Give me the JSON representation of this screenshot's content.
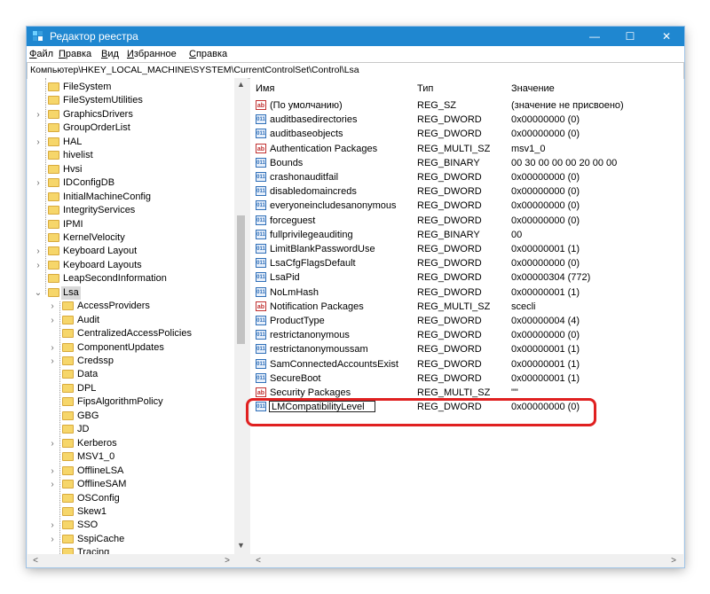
{
  "window": {
    "title": "Редактор реестра",
    "controls": {
      "minimize": "—",
      "maximize": "☐",
      "close": "✕"
    }
  },
  "menu": [
    "Файл",
    "Правка",
    "Вид",
    "Избранное",
    "Справка"
  ],
  "address": "Компьютер\\HKEY_LOCAL_MACHINE\\SYSTEM\\CurrentControlSet\\Control\\Lsa",
  "tree": {
    "items": [
      {
        "label": "FileSystem",
        "level": 0,
        "expander": ""
      },
      {
        "label": "FileSystemUtilities",
        "level": 0,
        "expander": ""
      },
      {
        "label": "GraphicsDrivers",
        "level": 0,
        "expander": ">"
      },
      {
        "label": "GroupOrderList",
        "level": 0,
        "expander": ""
      },
      {
        "label": "HAL",
        "level": 0,
        "expander": ">"
      },
      {
        "label": "hivelist",
        "level": 0,
        "expander": ""
      },
      {
        "label": "Hvsi",
        "level": 0,
        "expander": ""
      },
      {
        "label": "IDConfigDB",
        "level": 0,
        "expander": ">"
      },
      {
        "label": "InitialMachineConfig",
        "level": 0,
        "expander": ""
      },
      {
        "label": "IntegrityServices",
        "level": 0,
        "expander": ""
      },
      {
        "label": "IPMI",
        "level": 0,
        "expander": ""
      },
      {
        "label": "KernelVelocity",
        "level": 0,
        "expander": ""
      },
      {
        "label": "Keyboard Layout",
        "level": 0,
        "expander": ">"
      },
      {
        "label": "Keyboard Layouts",
        "level": 0,
        "expander": ">"
      },
      {
        "label": "LeapSecondInformation",
        "level": 0,
        "expander": ""
      },
      {
        "label": "Lsa",
        "level": 0,
        "expander": "v",
        "selected": true
      },
      {
        "label": "AccessProviders",
        "level": 1,
        "expander": ">"
      },
      {
        "label": "Audit",
        "level": 1,
        "expander": ">"
      },
      {
        "label": "CentralizedAccessPolicies",
        "level": 1,
        "expander": ""
      },
      {
        "label": "ComponentUpdates",
        "level": 1,
        "expander": ">"
      },
      {
        "label": "Credssp",
        "level": 1,
        "expander": ">"
      },
      {
        "label": "Data",
        "level": 1,
        "expander": ""
      },
      {
        "label": "DPL",
        "level": 1,
        "expander": ""
      },
      {
        "label": "FipsAlgorithmPolicy",
        "level": 1,
        "expander": ""
      },
      {
        "label": "GBG",
        "level": 1,
        "expander": ""
      },
      {
        "label": "JD",
        "level": 1,
        "expander": ""
      },
      {
        "label": "Kerberos",
        "level": 1,
        "expander": ">"
      },
      {
        "label": "MSV1_0",
        "level": 1,
        "expander": ""
      },
      {
        "label": "OfflineLSA",
        "level": 1,
        "expander": ">"
      },
      {
        "label": "OfflineSAM",
        "level": 1,
        "expander": ">"
      },
      {
        "label": "OSConfig",
        "level": 1,
        "expander": ""
      },
      {
        "label": "Skew1",
        "level": 1,
        "expander": ""
      },
      {
        "label": "SSO",
        "level": 1,
        "expander": ">"
      },
      {
        "label": "SspiCache",
        "level": 1,
        "expander": ">"
      },
      {
        "label": "Tracing",
        "level": 1,
        "expander": ""
      }
    ]
  },
  "list": {
    "headers": {
      "name": "Имя",
      "type": "Тип",
      "value": "Значение"
    },
    "rows": [
      {
        "icon": "string-value-icon",
        "name": "(По умолчанию)",
        "type": "REG_SZ",
        "value": "(значение не присвоено)"
      },
      {
        "icon": "binary-value-icon",
        "name": "auditbasedirectories",
        "type": "REG_DWORD",
        "value": "0x00000000 (0)"
      },
      {
        "icon": "binary-value-icon",
        "name": "auditbaseobjects",
        "type": "REG_DWORD",
        "value": "0x00000000 (0)"
      },
      {
        "icon": "string-value-icon",
        "name": "Authentication Packages",
        "type": "REG_MULTI_SZ",
        "value": "msv1_0"
      },
      {
        "icon": "binary-value-icon",
        "name": "Bounds",
        "type": "REG_BINARY",
        "value": "00 30 00 00 00 20 00 00"
      },
      {
        "icon": "binary-value-icon",
        "name": "crashonauditfail",
        "type": "REG_DWORD",
        "value": "0x00000000 (0)"
      },
      {
        "icon": "binary-value-icon",
        "name": "disabledomaincreds",
        "type": "REG_DWORD",
        "value": "0x00000000 (0)"
      },
      {
        "icon": "binary-value-icon",
        "name": "everyoneincludesanonymous",
        "type": "REG_DWORD",
        "value": "0x00000000 (0)"
      },
      {
        "icon": "binary-value-icon",
        "name": "forceguest",
        "type": "REG_DWORD",
        "value": "0x00000000 (0)"
      },
      {
        "icon": "binary-value-icon",
        "name": "fullprivilegeauditing",
        "type": "REG_BINARY",
        "value": "00"
      },
      {
        "icon": "binary-value-icon",
        "name": "LimitBlankPasswordUse",
        "type": "REG_DWORD",
        "value": "0x00000001 (1)"
      },
      {
        "icon": "binary-value-icon",
        "name": "LsaCfgFlagsDefault",
        "type": "REG_DWORD",
        "value": "0x00000000 (0)"
      },
      {
        "icon": "binary-value-icon",
        "name": "LsaPid",
        "type": "REG_DWORD",
        "value": "0x00000304 (772)"
      },
      {
        "icon": "binary-value-icon",
        "name": "NoLmHash",
        "type": "REG_DWORD",
        "value": "0x00000001 (1)"
      },
      {
        "icon": "string-value-icon",
        "name": "Notification Packages",
        "type": "REG_MULTI_SZ",
        "value": "scecli"
      },
      {
        "icon": "binary-value-icon",
        "name": "ProductType",
        "type": "REG_DWORD",
        "value": "0x00000004 (4)"
      },
      {
        "icon": "binary-value-icon",
        "name": "restrictanonymous",
        "type": "REG_DWORD",
        "value": "0x00000000 (0)"
      },
      {
        "icon": "binary-value-icon",
        "name": "restrictanonymoussam",
        "type": "REG_DWORD",
        "value": "0x00000001 (1)"
      },
      {
        "icon": "binary-value-icon",
        "name": "SamConnectedAccountsExist",
        "type": "REG_DWORD",
        "value": "0x00000001 (1)"
      },
      {
        "icon": "binary-value-icon",
        "name": "SecureBoot",
        "type": "REG_DWORD",
        "value": "0x00000001 (1)"
      },
      {
        "icon": "string-value-icon",
        "name": "Security Packages",
        "type": "REG_MULTI_SZ",
        "value": "\"\""
      },
      {
        "icon": "binary-value-icon",
        "name": "LMCompatibilityLevel",
        "type": "REG_DWORD",
        "value": "0x00000000 (0)",
        "editing": true
      }
    ]
  },
  "colors": {
    "titlebar": "#1f87d0",
    "highlight": "#e02020",
    "folder": "#f6d66a"
  }
}
